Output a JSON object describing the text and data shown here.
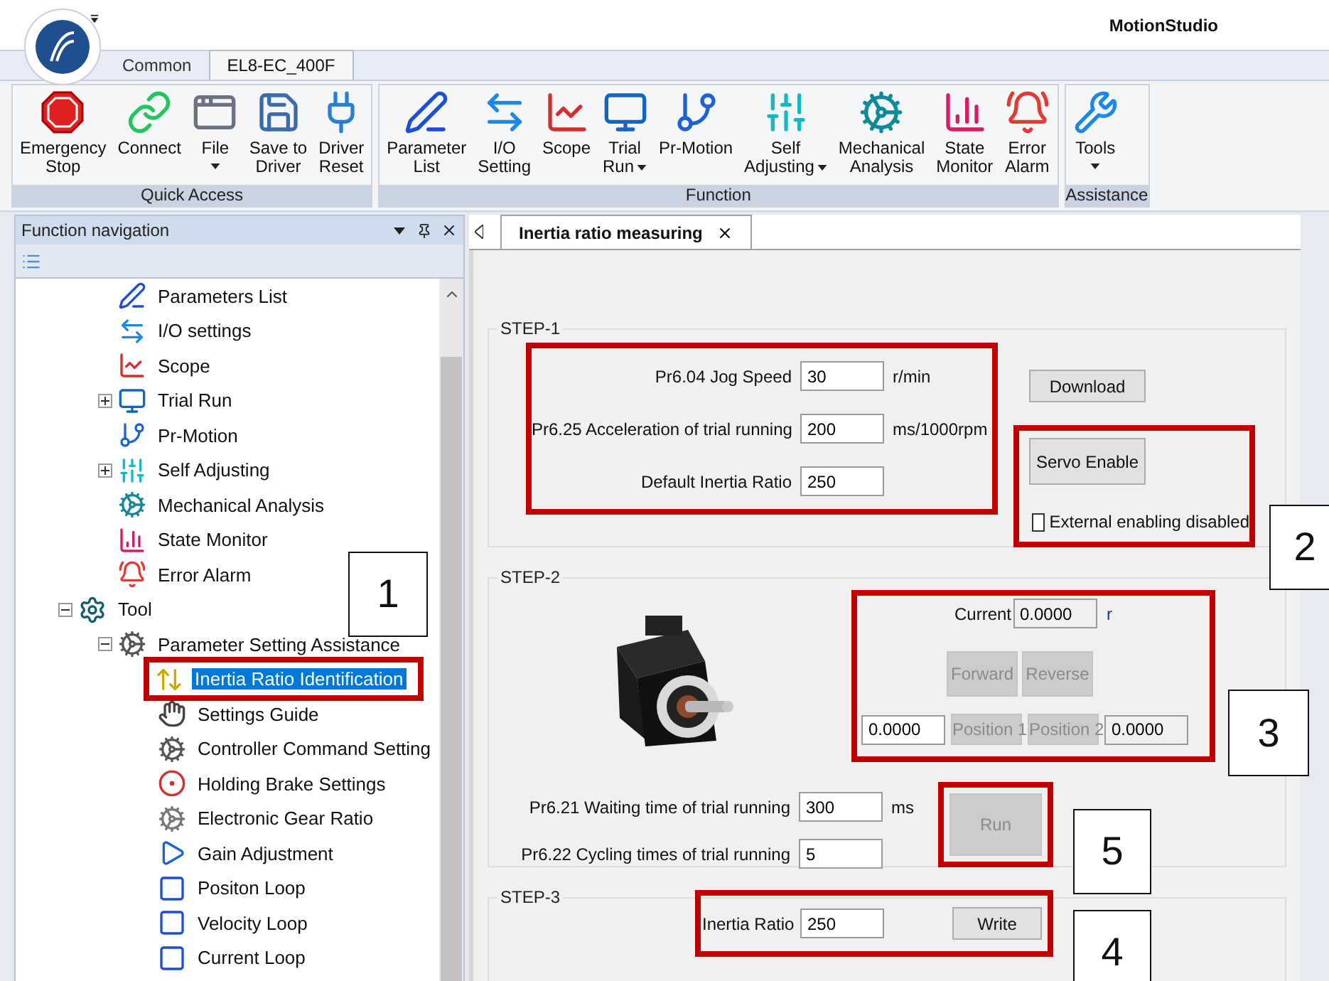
{
  "app_title": "MotionStudio",
  "ribbon_tabs": [
    {
      "label": "Common",
      "selected": false
    },
    {
      "label": "EL8-EC_400F",
      "selected": true
    }
  ],
  "ribbon_groups": [
    {
      "label": "Quick Access",
      "buttons": [
        {
          "label": "Emergency\nStop",
          "kind": "plain"
        },
        {
          "label": "Connect",
          "kind": "plain"
        },
        {
          "label": "File",
          "kind": "dropdown"
        },
        {
          "label": "Save to\nDriver",
          "kind": "plain"
        },
        {
          "label": "Driver\nReset",
          "kind": "plain"
        }
      ]
    },
    {
      "label": "Function",
      "buttons": [
        {
          "label": "Parameter\nList",
          "kind": "plain"
        },
        {
          "label": "I/O\nSetting",
          "kind": "plain"
        },
        {
          "label": "Scope",
          "kind": "plain"
        },
        {
          "label": "Trial\nRun",
          "kind": "inline"
        },
        {
          "label": "Pr-Motion",
          "kind": "plain"
        },
        {
          "label": "Self\nAdjusting",
          "kind": "inline"
        },
        {
          "label": "Mechanical\nAnalysis",
          "kind": "plain"
        },
        {
          "label": "State\nMonitor",
          "kind": "plain"
        },
        {
          "label": "Error\nAlarm",
          "kind": "plain"
        }
      ]
    },
    {
      "label": "Assistance",
      "buttons": [
        {
          "label": "Tools",
          "kind": "dropdown"
        }
      ]
    }
  ],
  "navigation": {
    "title": "Function navigation",
    "tree": [
      {
        "label": "Parameters List",
        "selected": false
      },
      {
        "label": "I/O settings",
        "selected": false
      },
      {
        "label": "Scope",
        "selected": false
      },
      {
        "label": "Trial Run",
        "selected": false,
        "expanded": false
      },
      {
        "label": "Pr-Motion",
        "selected": false
      },
      {
        "label": "Self Adjusting",
        "selected": false,
        "expanded": false
      },
      {
        "label": "Mechanical Analysis",
        "selected": false
      },
      {
        "label": "State Monitor",
        "selected": false
      },
      {
        "label": "Error Alarm",
        "selected": false
      },
      {
        "label": "Tool",
        "selected": false,
        "expanded": true,
        "children": [
          {
            "label": "Parameter Setting Assistance",
            "selected": false,
            "expanded": true,
            "children": [
              {
                "label": "Inertia Ratio Identification",
                "selected": true
              },
              {
                "label": "Settings Guide",
                "selected": false
              },
              {
                "label": "Controller Command Setting",
                "selected": false
              },
              {
                "label": "Holding Brake Settings",
                "selected": false
              },
              {
                "label": "Electronic Gear Ratio",
                "selected": false
              },
              {
                "label": "Gain Adjustment",
                "selected": false
              },
              {
                "label": "Positon Loop",
                "selected": false
              },
              {
                "label": "Velocity Loop",
                "selected": false
              },
              {
                "label": "Current Loop",
                "selected": false
              }
            ]
          }
        ]
      }
    ]
  },
  "document_tab": {
    "label": "Inertia ratio measuring"
  },
  "step1": {
    "legend": "STEP-1",
    "fields": [
      {
        "label": "Pr6.04 Jog Speed",
        "value": "30",
        "unit": "r/min"
      },
      {
        "label": "Pr6.25 Acceleration of trial running",
        "value": "200",
        "unit": "ms/1000rpm"
      },
      {
        "label": "Default Inertia Ratio",
        "value": "250"
      }
    ],
    "download_button": "Download",
    "servo_button": "Servo Enable",
    "external_checkbox": {
      "label": "External enabling disabled",
      "checked": false
    }
  },
  "step2": {
    "legend": "STEP-2",
    "current": {
      "label": "Current",
      "value": "0.0000",
      "unit": "r"
    },
    "jog_buttons": [
      {
        "label": "Forward",
        "disabled": true
      },
      {
        "label": "Reverse",
        "disabled": true
      }
    ],
    "position_1": {
      "value": "0.0000",
      "button": "Position 1",
      "disabled": true
    },
    "position_2": {
      "value": "0.0000",
      "button": "Position 2",
      "disabled": true
    },
    "fields": [
      {
        "label": "Pr6.21 Waiting time of trial running",
        "value": "300",
        "unit": "ms"
      },
      {
        "label": "Pr6.22 Cycling times of trial running",
        "value": "5"
      }
    ],
    "run_button": {
      "label": "Run",
      "disabled": true
    }
  },
  "step3": {
    "legend": "STEP-3",
    "label": "Inertia Ratio",
    "value": "250",
    "write_button": "Write"
  },
  "callouts": [
    "1",
    "2",
    "3",
    "5",
    "4"
  ]
}
